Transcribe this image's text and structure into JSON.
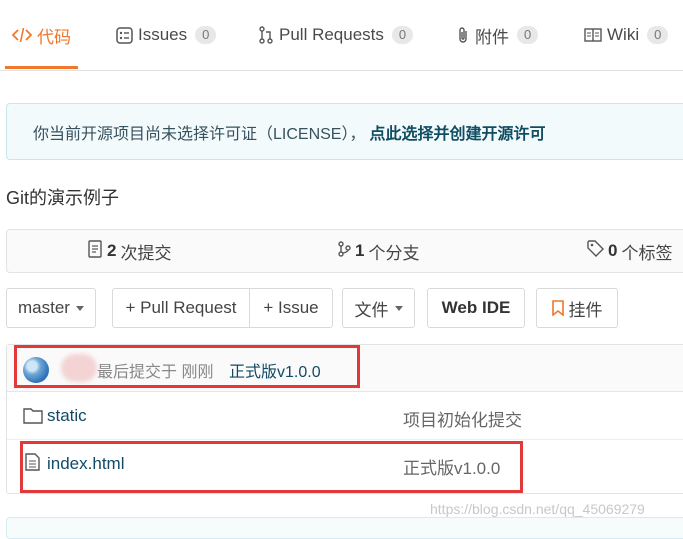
{
  "tabs": [
    {
      "label": "代码",
      "icon": "code-icon"
    },
    {
      "label": "Issues",
      "count": "0",
      "icon": "issues-icon"
    },
    {
      "label": "Pull Requests",
      "count": "0",
      "icon": "pull-request-icon"
    },
    {
      "label": "附件",
      "count": "0",
      "icon": "paperclip-icon"
    },
    {
      "label": "Wiki",
      "count": "0",
      "icon": "book-icon"
    }
  ],
  "notice": {
    "text": "你当前开源项目尚未选择许可证（LICENSE），",
    "link": "点此选择并创建开源许可"
  },
  "description": "Git的演示例子",
  "stats": {
    "commits_count": "2",
    "commits_label": "次提交",
    "branches_count": "1",
    "branches_label": "个分支",
    "tags_count": "0",
    "tags_label": "个标签"
  },
  "actions": {
    "branch": "master",
    "pull_request": "+ Pull Request",
    "issue": "+ Issue",
    "files": "文件",
    "web_ide": "Web IDE",
    "widget": "挂件"
  },
  "commit": {
    "text": "最后提交于 刚刚",
    "message": "正式版v1.0.0"
  },
  "files": [
    {
      "name": "static",
      "type": "folder",
      "message": "项目初始化提交"
    },
    {
      "name": "index.html",
      "type": "file",
      "message": "正式版v1.0.0"
    }
  ],
  "watermark": "https://blog.csdn.net/qq_45069279",
  "colors": {
    "accent": "#f0772b",
    "link": "#114a66",
    "highlight_box": "#e2383a"
  }
}
